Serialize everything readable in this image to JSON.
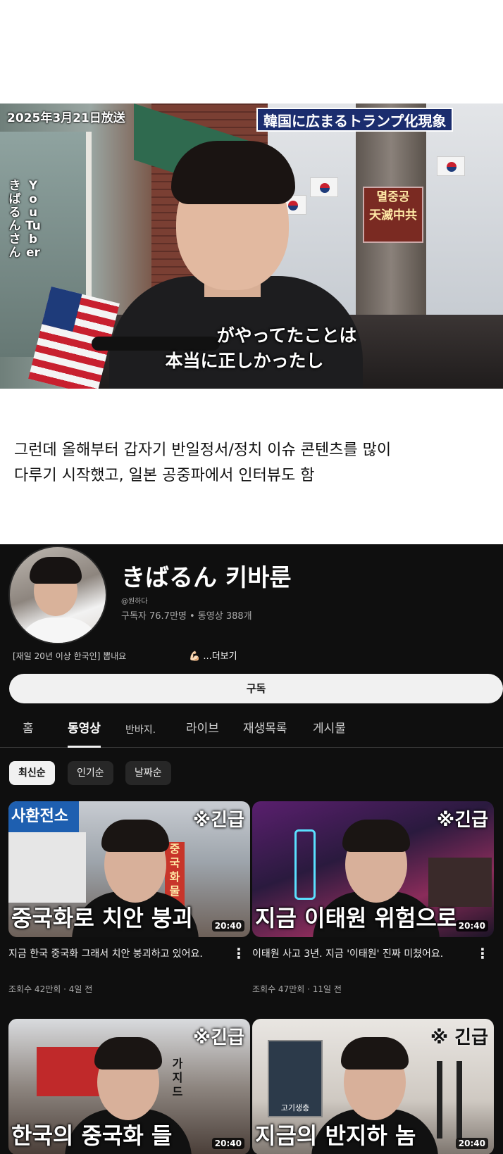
{
  "news": {
    "date_caption": "2025年3月21日放送",
    "headline": "韓国に広まるトランプ化現象",
    "speaker_name": "きばるんさん",
    "speaker_role": "YouTuber",
    "sign_text_1": "멸중공",
    "sign_text_2": "天滅中共",
    "subtitle_line1": "がやってたことは",
    "subtitle_line2": "本当に正しかったし"
  },
  "comment": {
    "line1": "그런데 올해부터 갑자기 반일정서/정치 이슈 콘텐츠를 많이",
    "line2": "다루기 시작했고, 일본 공중파에서 인터뷰도 함"
  },
  "channel": {
    "name": "きばるん 키바룬",
    "handle": "@원하다",
    "stats": "구독자 76.7만명 • 동영상 388개",
    "description": "[재일 20년 이상 한국인] 뽑내요",
    "more": "💪🏻 ...더보기",
    "subscribe_label": "구독",
    "tabs": [
      "홈",
      "동영상",
      "반바지.",
      "라이브",
      "재생목록",
      "게시물"
    ],
    "chips": [
      "최신순",
      "인기순",
      "날짜순"
    ]
  },
  "videos": [
    {
      "thumb_text": "중국화로 치안 붕괴",
      "thumb_tag": "※긴급",
      "shop_sign": "사환전소",
      "side_sign": "중국화물",
      "duration": "20:40",
      "title": "지금 한국 중국화 그래서 치안 붕괴하고 있어요.",
      "meta": "조회수 42만회 · 4일 전"
    },
    {
      "thumb_text": "지금 이태원 위험으로",
      "thumb_tag": "※긴급",
      "duration": "20:40",
      "title": "이태원 사고 3년. 지금 '이태원' 진짜 미쳤어요.",
      "meta": "조회수 47만회 · 11일 전"
    },
    {
      "thumb_text": "한국의 중국화 들",
      "thumb_tag": "※긴급",
      "side_sign": "가지드",
      "duration": "20:40"
    },
    {
      "thumb_text": "지금의 반지하 놈",
      "thumb_tag": "※ 긴급",
      "poster_text": "고기생충",
      "duration": "20:40"
    }
  ]
}
